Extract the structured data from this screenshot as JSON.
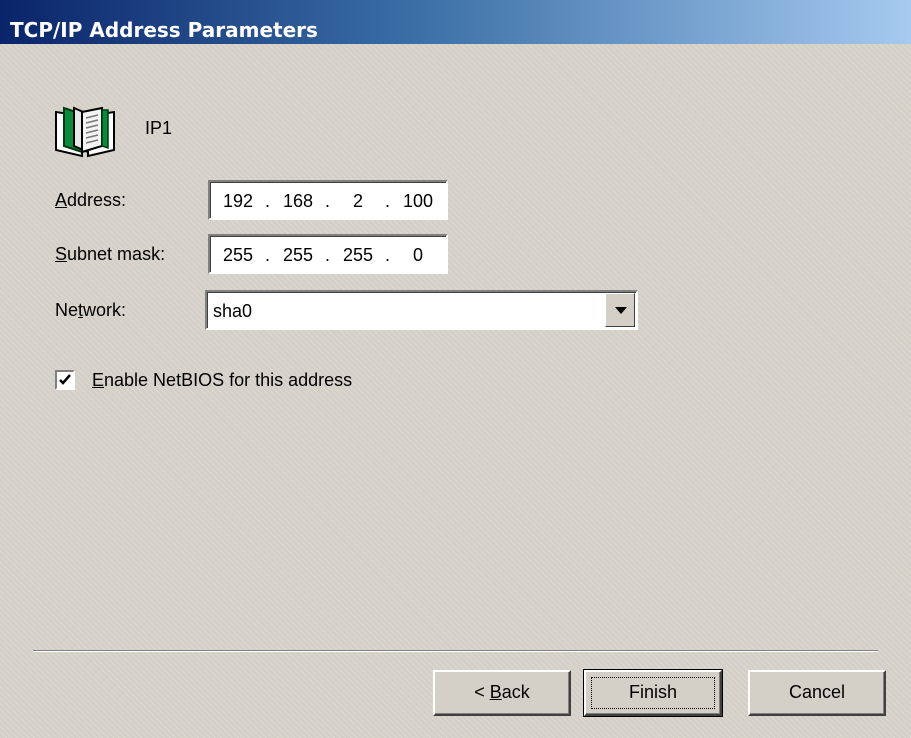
{
  "window": {
    "title": "TCP/IP Address Parameters"
  },
  "header": {
    "icon": "book-icon",
    "connection_name": "IP1"
  },
  "form": {
    "address": {
      "label_mnemonic": "A",
      "label_before": "",
      "label_after": "ddress:",
      "octets": [
        "192",
        "168",
        "2",
        "100"
      ]
    },
    "subnet": {
      "label_mnemonic": "S",
      "label_before": "",
      "label_after": "ubnet mask:",
      "octets": [
        "255",
        "255",
        "255",
        "0"
      ]
    },
    "network": {
      "label_before": "Ne",
      "label_mnemonic": "t",
      "label_after": "work:",
      "selected": "sha0"
    },
    "netbios": {
      "checked": true,
      "label_mnemonic": "E",
      "label_after": "nable NetBIOS for this address"
    }
  },
  "buttons": {
    "back": {
      "prefix": "< ",
      "mnemonic": "B",
      "rest": "ack"
    },
    "finish": {
      "label": "Finish"
    },
    "cancel": {
      "label": "Cancel"
    }
  },
  "colors": {
    "title_start": "#0a246a",
    "title_end": "#a6caf0",
    "face": "#d4d0c8",
    "icon_green": "#0a8a3a"
  }
}
